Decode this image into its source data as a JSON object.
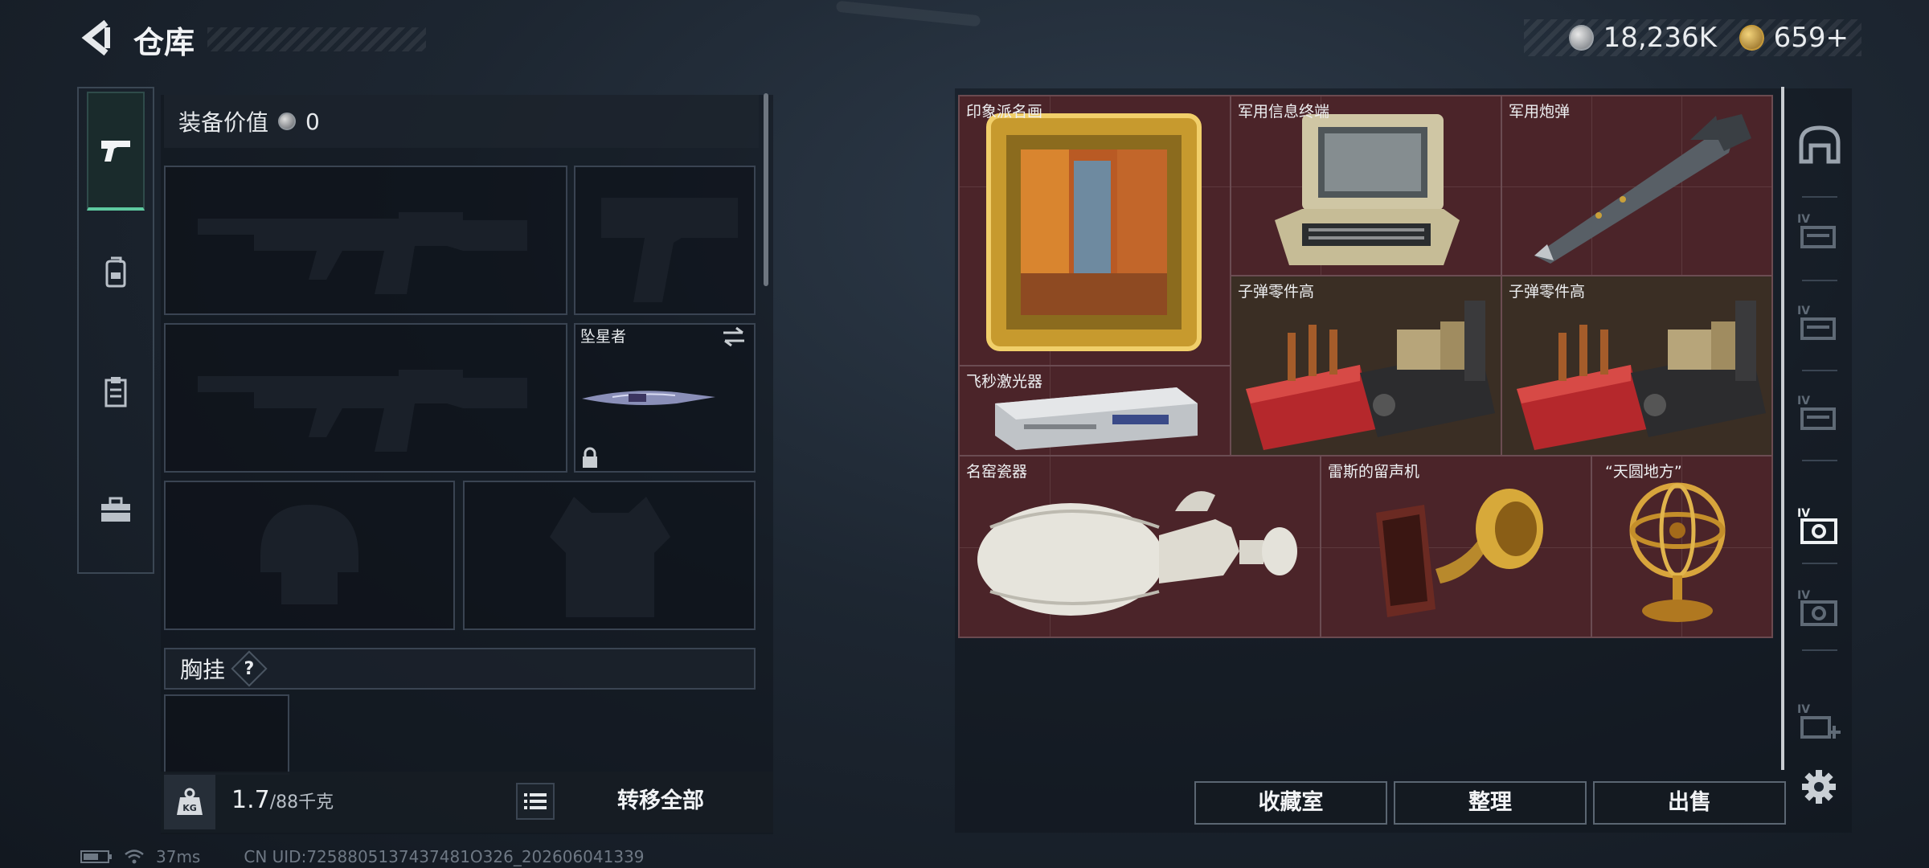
{
  "header": {
    "title": "仓库",
    "back_icon": "back-arrow-icon"
  },
  "currency": [
    {
      "icon": "silver-coin-icon",
      "value": "18,236K"
    },
    {
      "icon": "gold-coin-icon",
      "value": "659+"
    }
  ],
  "left_tabs": [
    {
      "name": "tab-weapons",
      "icon": "pistol-icon",
      "active": true
    },
    {
      "name": "tab-backpack",
      "icon": "backpack-icon",
      "active": false
    },
    {
      "name": "tab-chest-rig",
      "icon": "clipboard-icon",
      "active": false
    },
    {
      "name": "tab-case",
      "icon": "toolbox-icon",
      "active": false
    }
  ],
  "equipment": {
    "value_label": "装备价值",
    "value": "0",
    "knife_name": "坠星者",
    "chest_rig_label": "胸挂",
    "help_symbol": "?"
  },
  "weight": {
    "current": "1.7",
    "max": "/88千克",
    "icon": "weight-kg-icon"
  },
  "transfer_all_label": "转移全部",
  "stash_items": [
    {
      "label": "印象派名画",
      "icon": "framed-painting-icon"
    },
    {
      "label": "军用信息终端",
      "icon": "military-terminal-icon"
    },
    {
      "label": "军用炮弹",
      "icon": "artillery-shell-icon"
    },
    {
      "label": "子弹零件高",
      "icon": "ammo-parts-crate-icon"
    },
    {
      "label": "子弹零件高",
      "icon": "ammo-parts-crate-icon"
    },
    {
      "label": "飞秒激光器",
      "icon": "femtosecond-laser-icon"
    },
    {
      "label": "名窑瓷器",
      "icon": "porcelain-vase-icon"
    },
    {
      "label": "雷斯的留声机",
      "icon": "gramophone-icon"
    },
    {
      "label": "“天圆地方”",
      "icon": "armillary-sphere-icon"
    }
  ],
  "right_tabs": [
    {
      "icon": "stash-arch-icon",
      "level": ""
    },
    {
      "icon": "tier-iv-shelf-icon",
      "level": "IV"
    },
    {
      "icon": "tier-iv-shelf-icon",
      "level": "IV"
    },
    {
      "icon": "tier-iv-shelf-icon",
      "level": "IV"
    },
    {
      "icon": "tier-iv-vault-icon",
      "level": "IV",
      "active": true
    },
    {
      "icon": "tier-iv-vault-icon",
      "level": "IV"
    },
    {
      "icon": "tier-iv-add-icon",
      "level": "IV"
    }
  ],
  "actions": {
    "collection": "收藏室",
    "sort": "整理",
    "sell": "出售"
  },
  "status": {
    "ping": "37ms",
    "uid": "CN UID:7258805137437481O326_202606041339"
  },
  "colors": {
    "accent": "#5ecaa0",
    "stash_bg": "#4b2429",
    "panel": "#121820"
  }
}
